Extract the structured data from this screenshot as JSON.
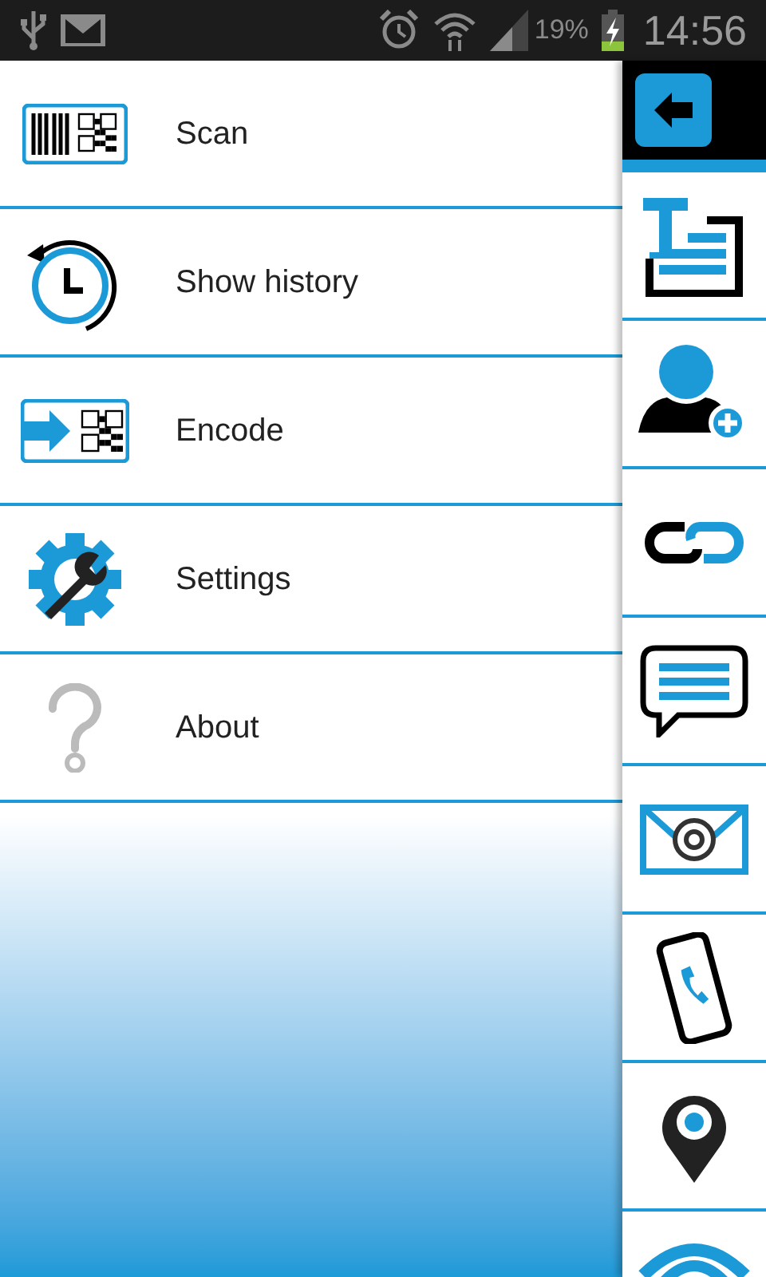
{
  "status_bar": {
    "battery": "19%",
    "time": "14:56"
  },
  "menu": [
    {
      "kind": "scan",
      "label": "Scan"
    },
    {
      "kind": "history",
      "label": "Show history"
    },
    {
      "kind": "encode",
      "label": "Encode"
    },
    {
      "kind": "settings",
      "label": "Settings"
    },
    {
      "kind": "about",
      "label": "About"
    }
  ],
  "sidebar": [
    {
      "kind": "text"
    },
    {
      "kind": "contact"
    },
    {
      "kind": "link"
    },
    {
      "kind": "sms"
    },
    {
      "kind": "email"
    },
    {
      "kind": "phone"
    },
    {
      "kind": "location"
    },
    {
      "kind": "wifi"
    }
  ]
}
